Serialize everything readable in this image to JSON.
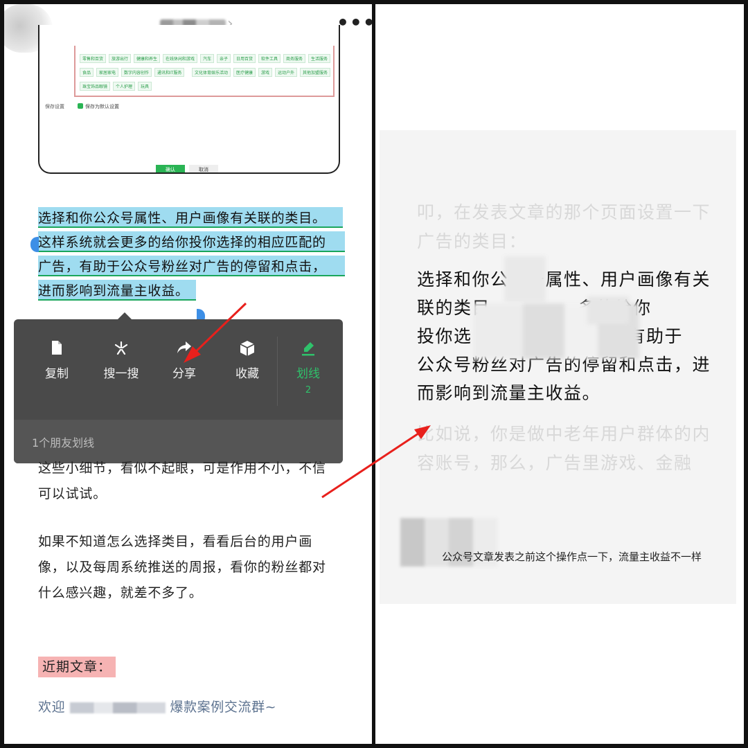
{
  "left_pane": {
    "menu_more_icon": "more-icon",
    "embedded_screenshot": {
      "tags_row1": [
        "零售和百货",
        "旅游出行",
        "健康和养生",
        "在线休闲和游戏",
        "汽车",
        "亲子",
        "日用百货",
        "软件工具",
        "商务服务",
        "生活服务"
      ],
      "tags_row2": [
        "食品",
        "家居家电",
        "数字内容创作",
        "通讯和IT服务",
        "文化体育娱乐活动",
        "医疗健康",
        "游戏",
        "运动户外",
        "其他加盟服务"
      ],
      "tags_row3": [
        "珠宝饰品眼镜",
        "个人护理",
        "玩具"
      ],
      "save_label": "保存设置",
      "save_option": "保存为默认设置",
      "ok_button": "确认",
      "cancel_button": "取消"
    },
    "highlighted_lines": [
      "选择和你公众号属性、用户画像有关联的类目。",
      "这样系统就会更多的给你投你选择的相应匹配的",
      "广告，有助于公众号粉丝对广告的停留和点击，",
      "进而影响到流量主收益。"
    ],
    "context_menu": {
      "items": [
        {
          "label": "复制",
          "icon": "copy-icon"
        },
        {
          "label": "搜一搜",
          "icon": "search-spark-icon"
        },
        {
          "label": "分享",
          "icon": "share-icon"
        },
        {
          "label": "收藏",
          "icon": "collect-icon"
        }
      ],
      "underline_item": {
        "label": "划线",
        "count": "2",
        "icon": "underline-pen-icon"
      },
      "footer": "1个朋友划线"
    },
    "paragraph_after_menu": [
      "这些小细节，看似不起眼，可是作用不小，不信",
      "可以试试。"
    ],
    "paragraph_categories": [
      "如果不知道怎么选择类目，看看后台的用户画",
      "像，以及每周系统推送的周报，看你的粉丝都对",
      "什么感兴趣，就差不多了。"
    ],
    "recent_label": "近期文章：",
    "welcome_prefix": "欢迎",
    "welcome_suffix": "爆款案例交流群~"
  },
  "right_pane": {
    "faded_top": [
      "叩，在发表文章的那个页面设置一下",
      "广告的类目："
    ],
    "main_lines": [
      "选择和你公众号属性、用户画像有关",
      "联的类目。",
      "投你选",
      "公众号粉丝对广告的停留和点击，进",
      "而影响到流量主收益。"
    ],
    "main_line2_tail": "多的给你",
    "main_line3_tail": "有助于",
    "faded_bottom": [
      "比如说，你是做中老年用户群体的内",
      "容账号，那么，广告里游戏、金融"
    ],
    "caption": "公众号文章发表之前这个操作点一下，流量主收益不一样"
  },
  "colors": {
    "highlight": "#9fdcf0",
    "underline": "#1aa65b",
    "menu_bg": "#4a4a4a",
    "accent_green": "#2fc26b",
    "arrow_red": "#e8201c",
    "recent_bg": "#f6b3b3",
    "link": "#5d7390"
  }
}
